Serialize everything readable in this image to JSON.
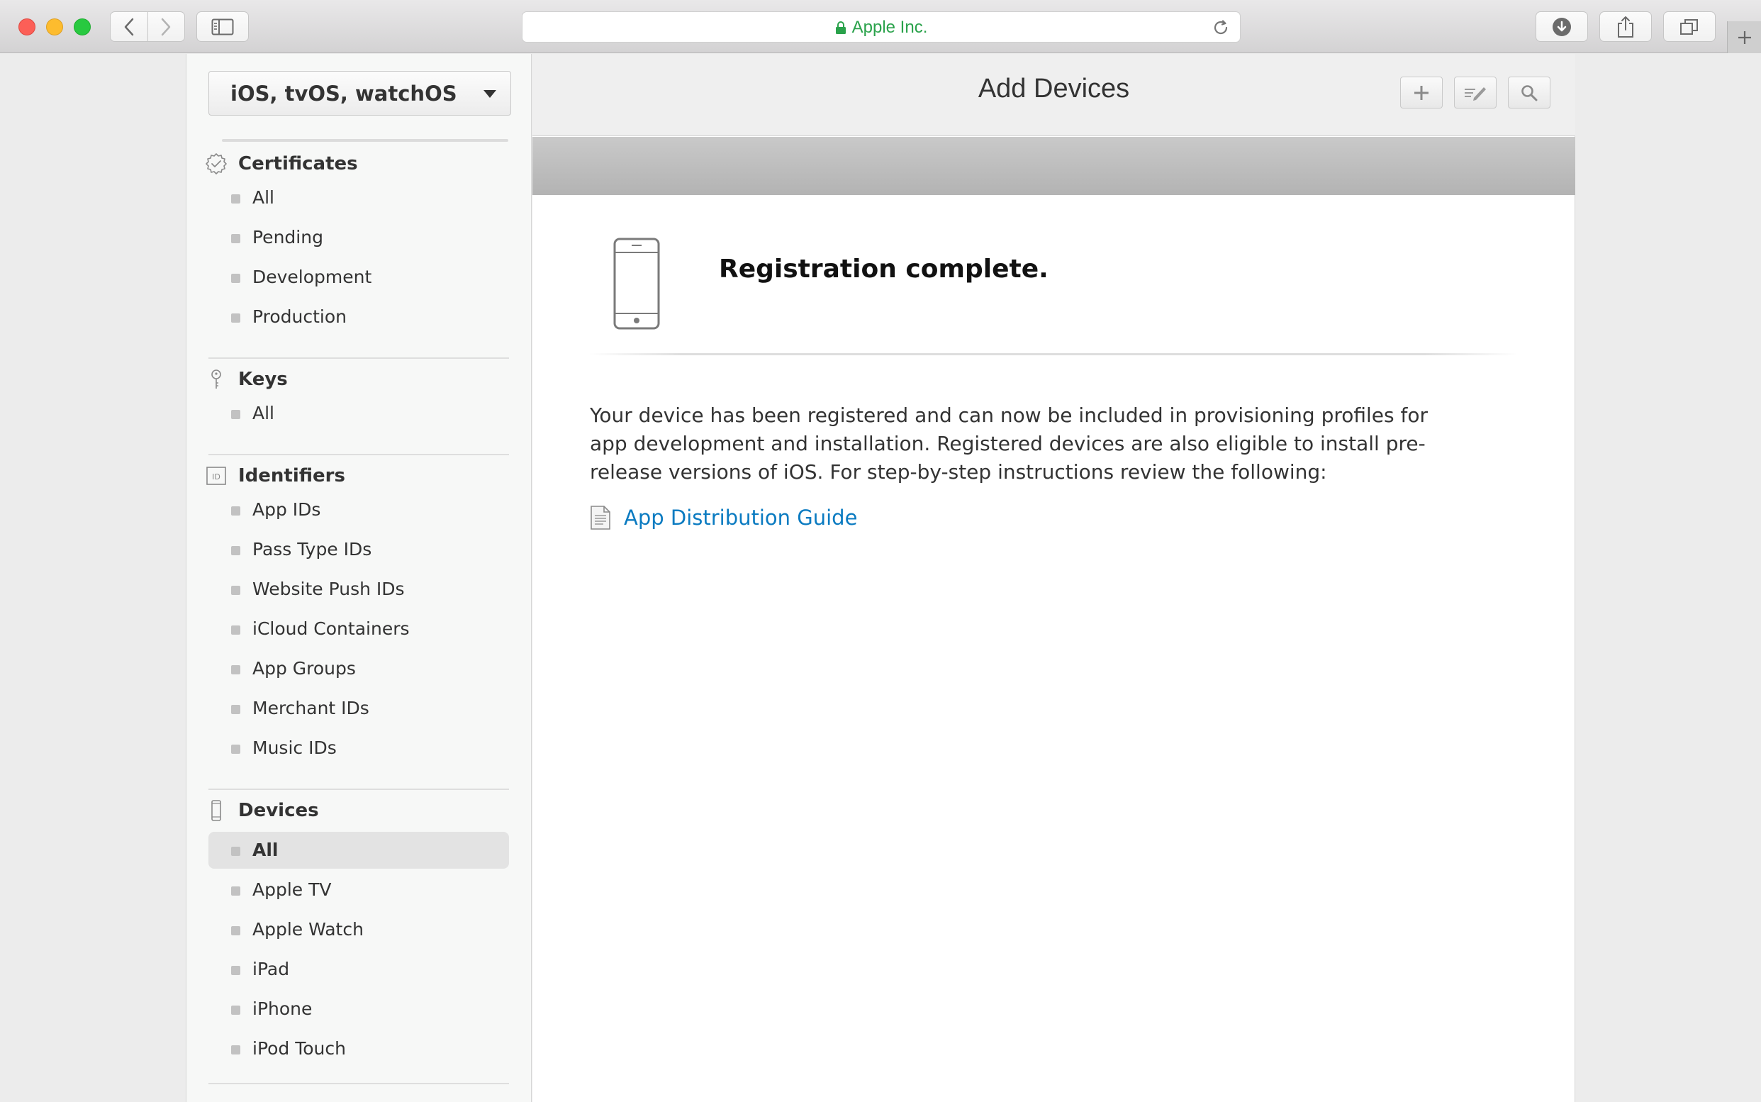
{
  "browser": {
    "site_label": "Apple Inc."
  },
  "sidebar": {
    "platform_select": "iOS, tvOS, watchOS",
    "sections": [
      {
        "title": "Certificates",
        "icon": "certificate-badge-icon",
        "items": [
          "All",
          "Pending",
          "Development",
          "Production"
        ]
      },
      {
        "title": "Keys",
        "icon": "key-icon",
        "items": [
          "All"
        ]
      },
      {
        "title": "Identifiers",
        "icon": "id-badge-icon",
        "items": [
          "App IDs",
          "Pass Type IDs",
          "Website Push IDs",
          "iCloud Containers",
          "App Groups",
          "Merchant IDs",
          "Music IDs"
        ]
      },
      {
        "title": "Devices",
        "icon": "device-icon",
        "items": [
          "All",
          "Apple TV",
          "Apple Watch",
          "iPad",
          "iPhone",
          "iPod Touch"
        ],
        "selected_item": "All"
      }
    ]
  },
  "main": {
    "title": "Add Devices",
    "buttons": [
      "add-icon",
      "edit-icon",
      "search-icon"
    ],
    "registration_title": "Registration complete.",
    "description": "Your device has been registered and can now be included in provisioning profiles for app development and installation. Registered devices are also eligible to install pre-release versions of iOS. For step-by-step instructions review the following:",
    "guide_link": "App Distribution Guide"
  },
  "colors": {
    "site_green": "#2aa24b",
    "link_blue": "#0b7bc1",
    "close": "#fc5f57",
    "minimize": "#fdbc2e",
    "zoom": "#28c940"
  }
}
